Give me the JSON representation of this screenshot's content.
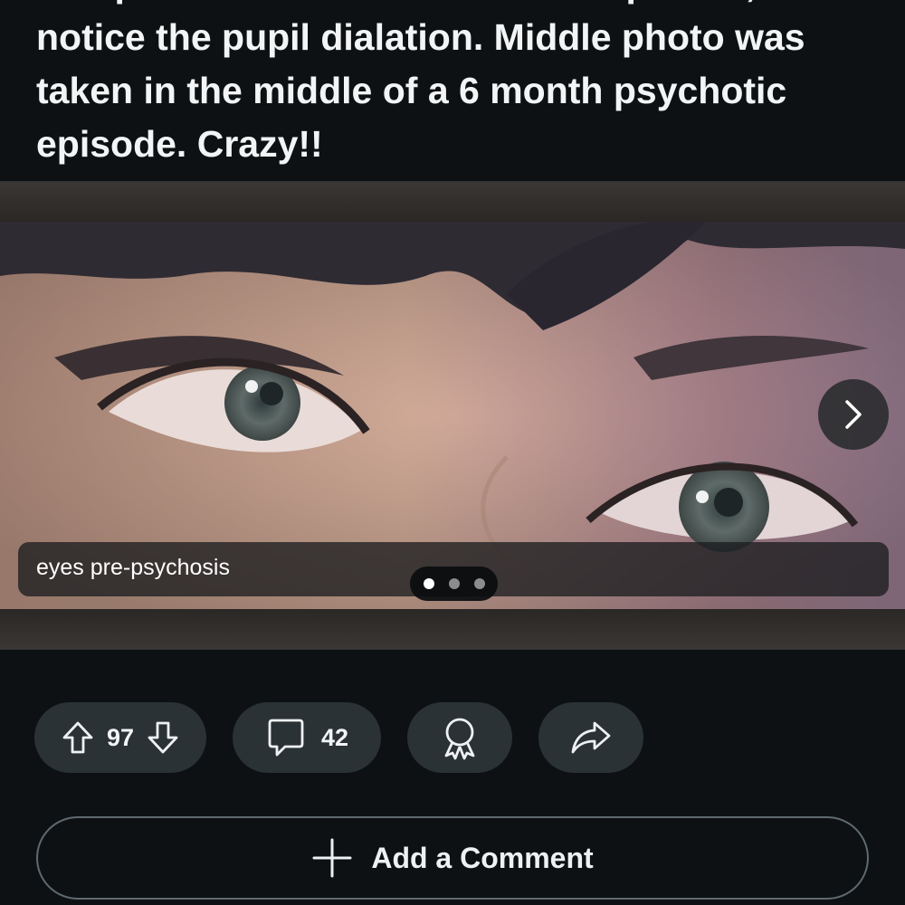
{
  "post": {
    "title": "Left photo was taken before the episode, notice the pupil dialation. Middle photo was taken in the middle of a 6 month psychotic episode. Crazy!!"
  },
  "gallery": {
    "caption": "eyes pre-psychosis",
    "slide_count": 3,
    "active_index": 0,
    "next_icon": "chevron-right-icon"
  },
  "actions": {
    "upvote_icon": "upvote-arrow-icon",
    "vote_count": "97",
    "downvote_icon": "downvote-arrow-icon",
    "comment_icon": "comment-bubble-icon",
    "comment_count": "42",
    "award_icon": "award-ribbon-icon",
    "share_icon": "share-arrow-icon"
  },
  "add_comment": {
    "icon": "plus-icon",
    "label": "Add a Comment"
  },
  "colors": {
    "background": "#0e1113",
    "pill": "#2a3236",
    "text": "#f2f4f5",
    "border": "#5f6a70"
  }
}
